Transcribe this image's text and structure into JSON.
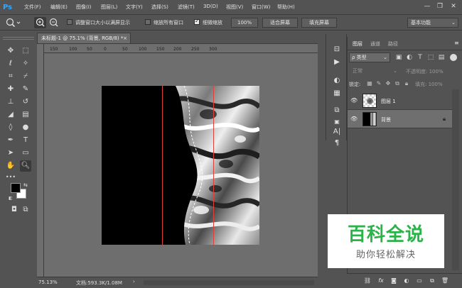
{
  "app": {
    "logo": "Ps"
  },
  "menu": {
    "items": [
      "文件(F)",
      "编辑(E)",
      "图像(I)",
      "图层(L)",
      "文字(Y)",
      "选择(S)",
      "滤镜(T)",
      "3D(D)",
      "视图(V)",
      "窗口(W)",
      "帮助(H)"
    ]
  },
  "window_controls": {
    "minimize": "—",
    "restore": "❐",
    "close": "✕"
  },
  "options": {
    "resize_windows_label": "调整窗口大小以满屏显示",
    "resize_windows_checked": false,
    "zoom_all_label": "缩放所有窗口",
    "zoom_all_checked": false,
    "scrubby_zoom_label": "细微缩放",
    "scrubby_zoom_checked": true,
    "zoom_100_label": "100%",
    "fit_screen_label": "适合屏幕",
    "fill_screen_label": "填充屏幕",
    "workspace": "基本功能"
  },
  "document": {
    "tab_title": "未标题-1 @ 75.1% (背景, RGB/8) *",
    "close_glyph": "×",
    "ruler_ticks": [
      "150",
      "100",
      "50",
      "0",
      "50",
      "100",
      "150",
      "200",
      "250",
      "300"
    ]
  },
  "status": {
    "zoom": "75.13%",
    "doc_info": "文档:593.3K/1.08M",
    "arrow": "›"
  },
  "layers_panel": {
    "tabs": [
      "图层",
      "通道",
      "路径"
    ],
    "active_tab": "图层",
    "kind_filter": "ρ 类型",
    "blend_mode": "正常",
    "opacity_label": "不透明度: 100%",
    "lock_label": "锁定:",
    "fill_label": "填充: 100%",
    "layers": [
      {
        "name": "图层 1",
        "visible": true,
        "selected": false,
        "locked": false
      },
      {
        "name": "背景",
        "visible": true,
        "selected": true,
        "locked": true
      }
    ]
  },
  "watermark": {
    "title": "百科全说",
    "subtitle": "助你轻松解决"
  },
  "colors": {
    "chrome": "#535353",
    "canvas_bg": "#6e6e6e",
    "guide_red": "#e0403a",
    "brand_green": "#2bb34a",
    "ps_blue": "#31a8ff"
  }
}
